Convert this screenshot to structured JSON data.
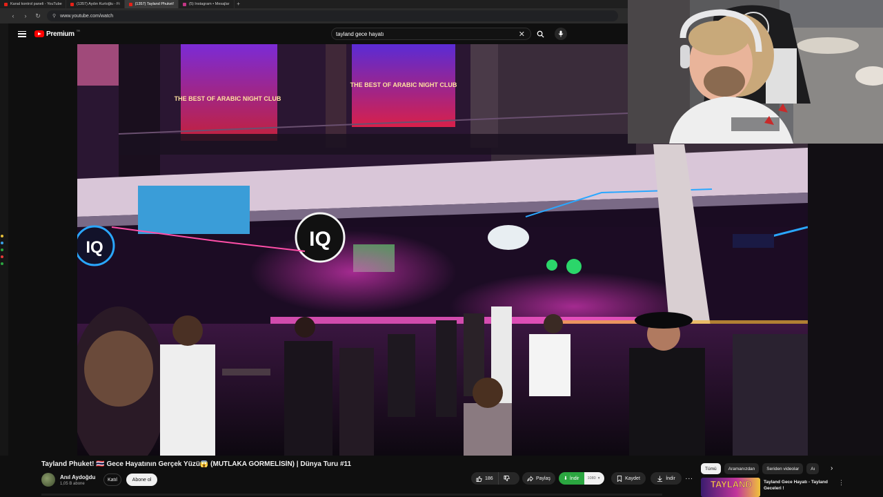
{
  "browser": {
    "tabs": [
      {
        "label": "Kanal kontrol paneli - YouTube",
        "icon": "youtube-icon",
        "active": false
      },
      {
        "label": "(1357) Aydın Kurtoğlu - Fi",
        "icon": "youtube-icon",
        "active": false
      },
      {
        "label": "(1357) Tayland Phuket!",
        "icon": "youtube-icon",
        "active": true
      },
      {
        "label": "(5) Instagram • Mesajlar",
        "icon": "instagram-icon",
        "active": false
      }
    ],
    "new_tab_label": "+",
    "url": "www.youtube.com/watch"
  },
  "header": {
    "logo_text": "Premium",
    "logo_sup": "TR",
    "search_value": "tayland gece hayatı",
    "clear_glyph": "✕"
  },
  "video": {
    "title": "Tayland Phuket! 🇹🇭 Gece Hayatının Gerçek Yüzü😱 (MUTLAKA GÖRMELİSİN) | Dünya Turu #11",
    "scene_signs": {
      "screen_left": "THE BEST OF ARABIC NIGHT CLUB",
      "screen_right": "THE BEST OF ARABIC NIGHT CLUB",
      "logo_iq": "IQ",
      "logo_iq_small": "IQ"
    }
  },
  "channel": {
    "name": "Anıl Aydoğdu",
    "subscribers": "1,05 B abone",
    "join_label": "Katıl",
    "subscribe_label": "Abone ol"
  },
  "actions": {
    "like_count": "186",
    "share_label": "Paylaş",
    "download_label": "İndir",
    "download_quality": "1080",
    "save_label": "Kaydet",
    "download2_label": "İndir",
    "more_glyph": "···"
  },
  "sidebar": {
    "chips": [
      "Tümü",
      "Aramanızdan",
      "Seriden videolar",
      "Aı"
    ],
    "chips_arrow": "›",
    "recommended": {
      "thumb_text": "TAYLAND",
      "title": "Tayland Gece Hayatı - Tayland Geceleri !"
    }
  },
  "colors": {
    "yt_red": "#ff0000",
    "download_green": "#2ba640",
    "neon_pink": "#ff2bd6",
    "neon_blue": "#27b8ff"
  }
}
